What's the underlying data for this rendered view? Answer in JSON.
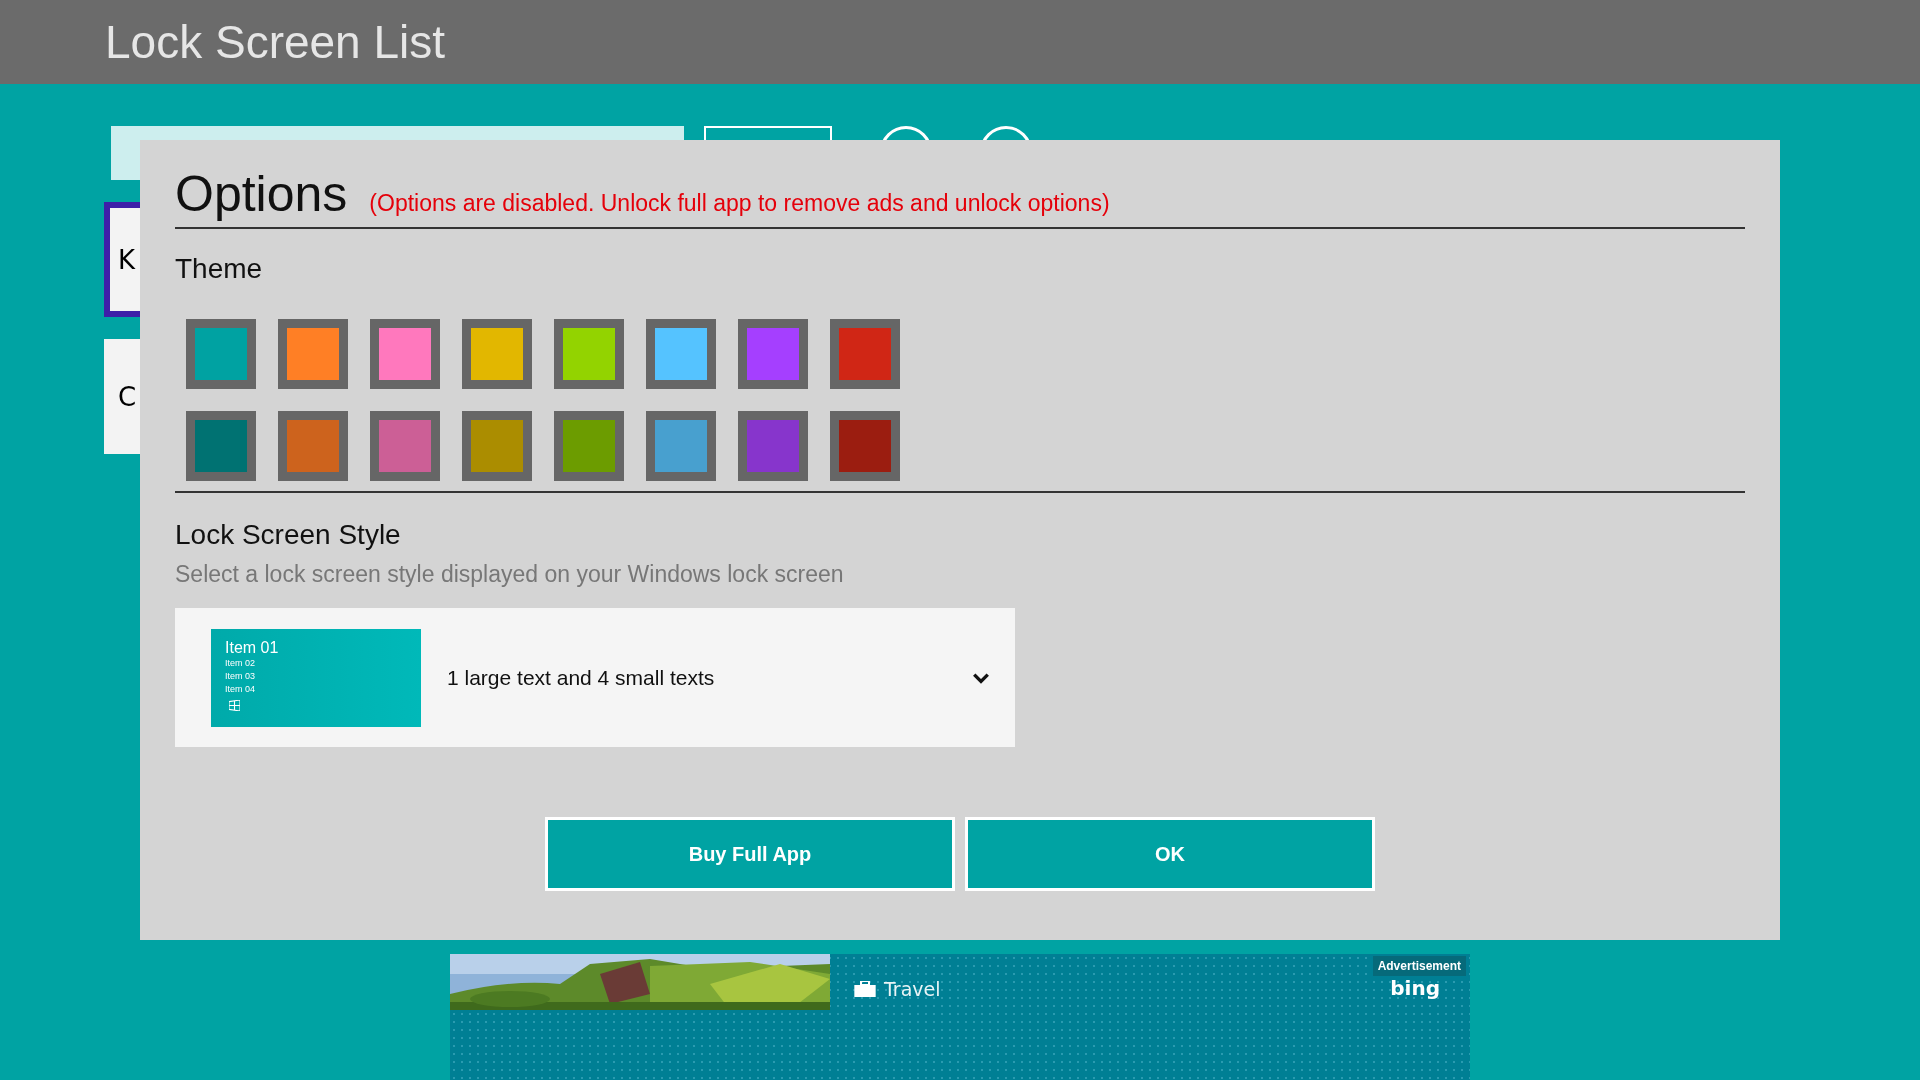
{
  "app_bar": {
    "title": "Lock Screen List"
  },
  "background": {
    "cards": [
      {
        "label": "K",
        "selected": true
      },
      {
        "label": "C",
        "selected": false
      }
    ]
  },
  "options": {
    "title": "Options",
    "notice": "(Options are disabled. Unlock full app to remove ads and unlock options)",
    "theme": {
      "heading": "Theme",
      "rows": [
        [
          {
            "color": "#00a2a2"
          },
          {
            "color": "#ff7f25"
          },
          {
            "color": "#ff78bd"
          },
          {
            "color": "#e2b700"
          },
          {
            "color": "#93d300"
          },
          {
            "color": "#55c3ff"
          },
          {
            "color": "#a53fff"
          },
          {
            "color": "#d02615"
          }
        ],
        [
          {
            "color": "#007272"
          },
          {
            "color": "#cd631d"
          },
          {
            "color": "#cc5f96"
          },
          {
            "color": "#ab8d00"
          },
          {
            "color": "#6c9c00"
          },
          {
            "color": "#48a0cf"
          },
          {
            "color": "#8735cc"
          },
          {
            "color": "#9b1d10"
          }
        ]
      ]
    },
    "lock_style": {
      "heading": "Lock Screen Style",
      "description": "Select a lock screen style displayed on your Windows lock screen",
      "preview": {
        "large": "Item 01",
        "small": [
          "Item 02",
          "Item 03",
          "Item 04"
        ]
      },
      "value": "1 large text and 4 small texts"
    },
    "buttons": [
      "Buy Full App",
      "OK"
    ]
  },
  "ad": {
    "category": "Travel",
    "label": "Advertisement",
    "brand": "bing"
  }
}
